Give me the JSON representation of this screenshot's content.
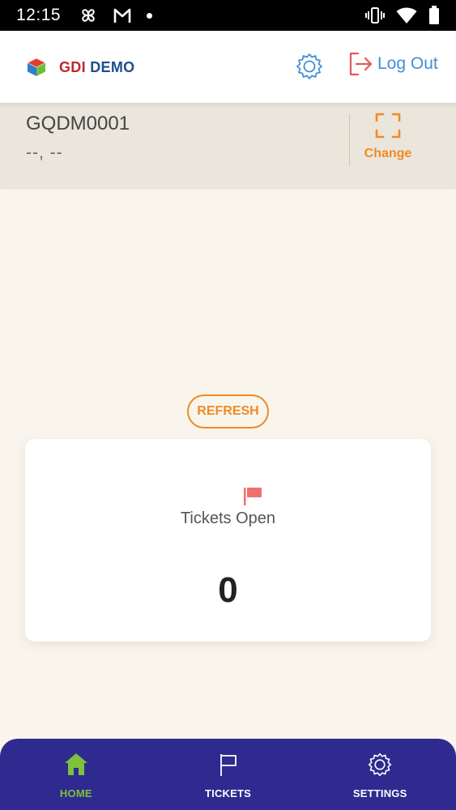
{
  "status_bar": {
    "time": "12:15",
    "icons_left": [
      "pinwheel-icon",
      "gmail-icon",
      "notification-dot-icon"
    ],
    "icons_right": [
      "vibrate-icon",
      "wifi-icon",
      "battery-icon"
    ]
  },
  "header": {
    "logo_text_gdi": "GDI",
    "logo_text_demo": "DEMO",
    "settings_icon": "gear-icon",
    "logout_label": "Log Out",
    "colors": {
      "logout": "#3f8fd7",
      "gdi": "#c0272d",
      "demo": "#1f4e8c"
    }
  },
  "device": {
    "id": "GQDM0001",
    "location": "--, --",
    "change_label": "Change",
    "change_icon": "scan-frame-icon"
  },
  "refresh": {
    "label": "REFRESH",
    "color": "#f08a24"
  },
  "card": {
    "icon": "flag-icon",
    "title": "Tickets Open",
    "count": "0"
  },
  "bottom_nav": {
    "background": "#2e2a8f",
    "active_color": "#7fc03c",
    "items": [
      {
        "label": "HOME",
        "icon": "home-icon",
        "active": true
      },
      {
        "label": "TICKETS",
        "icon": "flag-icon",
        "active": false
      },
      {
        "label": "SETTINGS",
        "icon": "gear-icon",
        "active": false
      }
    ]
  }
}
